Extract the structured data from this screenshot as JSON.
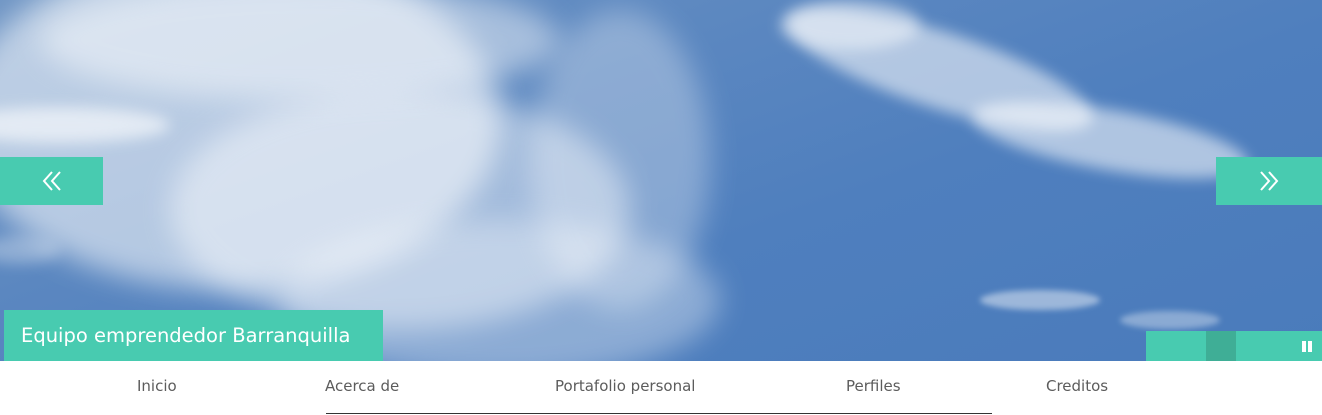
{
  "slider": {
    "prev_icon": "double-chevron-left-icon",
    "next_icon": "double-chevron-right-icon",
    "caption": "Equipo emprendedor Barranquilla",
    "pause_icon": "pause-icon"
  },
  "nav": {
    "items": [
      {
        "label": "Inicio"
      },
      {
        "label": "Acerca de"
      },
      {
        "label": "Portafolio personal"
      },
      {
        "label": "Perfiles"
      },
      {
        "label": "Creditos"
      }
    ]
  },
  "colors": {
    "accent": "#48cbb0",
    "accent_dark": "#3fae96",
    "sky": "#4f7fbe",
    "nav_text": "#5c5c5c"
  }
}
